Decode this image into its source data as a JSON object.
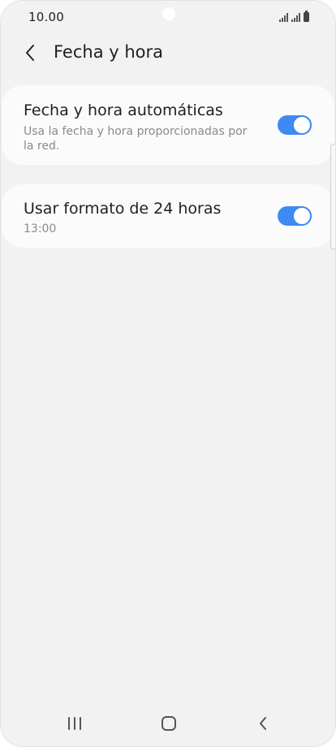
{
  "status_bar": {
    "time": "10.00"
  },
  "header": {
    "title": "Fecha y hora",
    "back_icon": "chevron-left-icon"
  },
  "settings": [
    {
      "title": "Fecha y hora automáticas",
      "subtitle": "Usa la fecha y hora proporcionadas por la red.",
      "toggle_on": true
    },
    {
      "title": "Usar formato de 24 horas",
      "subtitle": "13:00",
      "toggle_on": true
    }
  ],
  "navigation": {
    "icons": [
      "recents-icon",
      "home-icon",
      "back-icon"
    ]
  },
  "colors": {
    "background": "#f2f2f2",
    "card": "#fbfbfb",
    "accent": "#3e8af3",
    "title_text": "#1f1f1f",
    "subtitle_text": "#8a8a8a"
  }
}
